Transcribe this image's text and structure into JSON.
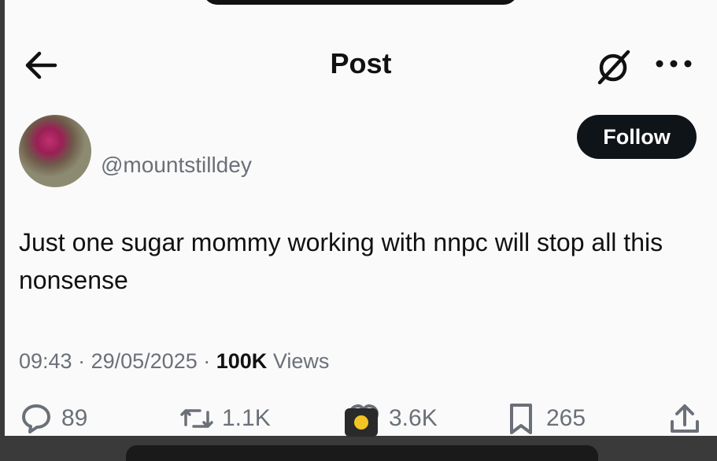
{
  "header": {
    "title": "Post"
  },
  "post": {
    "handle": "@mountstilldey",
    "follow_label": "Follow",
    "text": "Just one sugar mommy working with nnpc will stop all this nonsense",
    "time": "09:43",
    "date": "29/05/2025",
    "views_count": "100K",
    "views_label": "Views"
  },
  "actions": {
    "replies": "89",
    "reposts": "1.1K",
    "likes": "3.6K",
    "bookmarks": "265"
  },
  "icons": {
    "back": "arrow-left-icon",
    "grok": "grok-icon",
    "more": "more-icon",
    "reply": "reply-icon",
    "repost": "repost-icon",
    "like": "heart-icon",
    "bookmark": "bookmark-icon",
    "share": "share-icon"
  }
}
